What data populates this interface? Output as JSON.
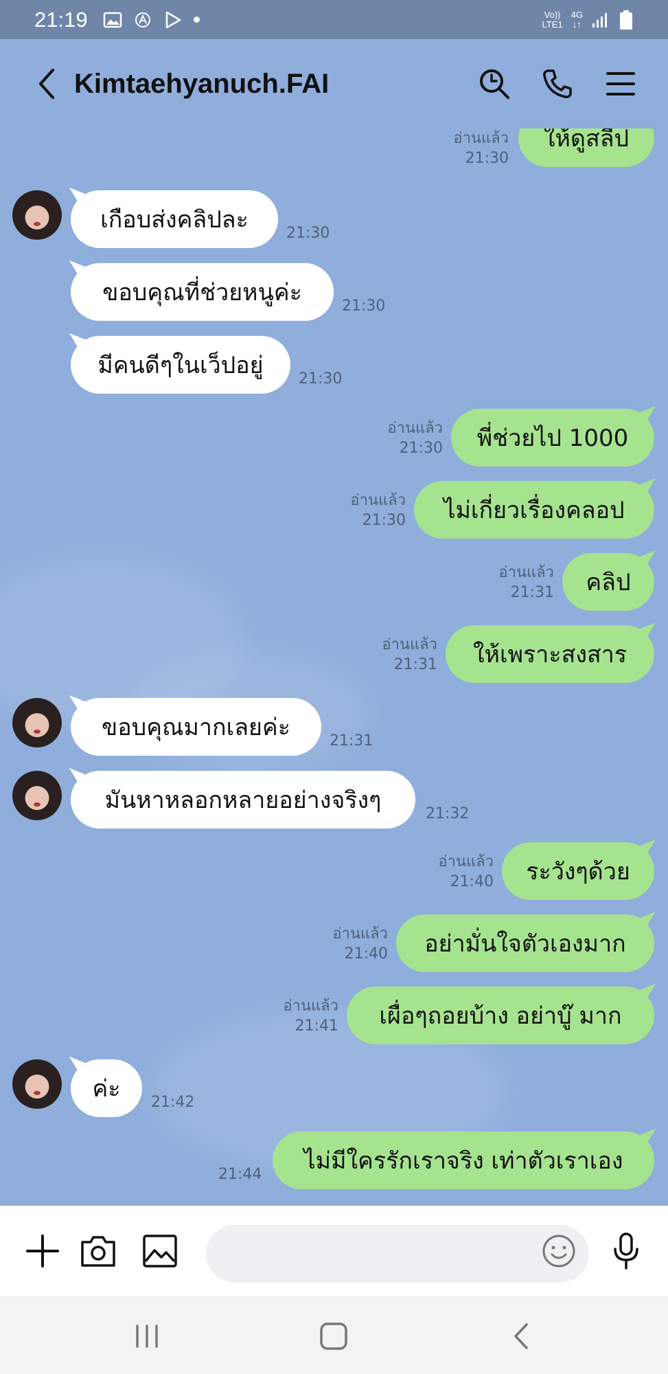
{
  "status_bar": {
    "time": "21:19",
    "network_top": "Vo))",
    "network_bottom": "LTE1",
    "net_type": "4G"
  },
  "header": {
    "title": "Kimtaehyanuch.FAI"
  },
  "read_label": "อ่านแล้ว",
  "messages": [
    {
      "side": "out",
      "text": "ให้ดูสลีป",
      "time": "21:30",
      "read": "อ่านแล้ว"
    },
    {
      "side": "in",
      "text": "เกือบส่งคลิปละ",
      "time": "21:30"
    },
    {
      "side": "in",
      "text": "ขอบคุณที่ช่วยหนูค่ะ",
      "time": "21:30"
    },
    {
      "side": "in",
      "text": "มีคนดีๆในเว็ปอยู่",
      "time": "21:30"
    },
    {
      "side": "out",
      "text": "พี่ช่วยไป 1000",
      "time": "21:30",
      "read": "อ่านแล้ว"
    },
    {
      "side": "out",
      "text": "ไม่เกี่ยวเรื่องคลอป",
      "time": "21:30",
      "read": "อ่านแล้ว"
    },
    {
      "side": "out",
      "text": "คลิป",
      "time": "21:31",
      "read": "อ่านแล้ว"
    },
    {
      "side": "out",
      "text": "ให้เพราะสงสาร",
      "time": "21:31",
      "read": "อ่านแล้ว"
    },
    {
      "side": "in",
      "text": "ขอบคุณมากเลยค่ะ",
      "time": "21:31"
    },
    {
      "side": "in",
      "text": "มันหาหลอกหลายอย่างจริงๆ",
      "time": "21:32"
    },
    {
      "side": "out",
      "text": "ระวังๆด้วย",
      "time": "21:40",
      "read": "อ่านแล้ว"
    },
    {
      "side": "out",
      "text": "อย่ามั่นใจตัวเองมาก",
      "time": "21:40",
      "read": "อ่านแล้ว"
    },
    {
      "side": "out",
      "text": "เผื่อๆถอยบ้าง อย่าบู๊ มาก",
      "time": "21:41",
      "read": "อ่านแล้ว"
    },
    {
      "side": "in",
      "text": "ค่ะ",
      "time": "21:42"
    },
    {
      "side": "out",
      "text": "ไม่มีใครรักเราจริง เท่าตัวเราเอง",
      "time": "21:44"
    }
  ],
  "input": {
    "placeholder": ""
  },
  "icons": {
    "back": "chevron-left-icon",
    "search": "search-icon",
    "call": "phone-icon",
    "menu": "menu-icon",
    "add": "plus-icon",
    "camera": "camera-icon",
    "gallery": "image-icon",
    "emoji": "emoji-icon",
    "mic": "microphone-icon"
  },
  "colors": {
    "chat_bg": "#8faedc",
    "status_bar": "#6f86a8",
    "outgoing_bubble": "#a6e38f",
    "incoming_bubble": "#ffffff"
  }
}
